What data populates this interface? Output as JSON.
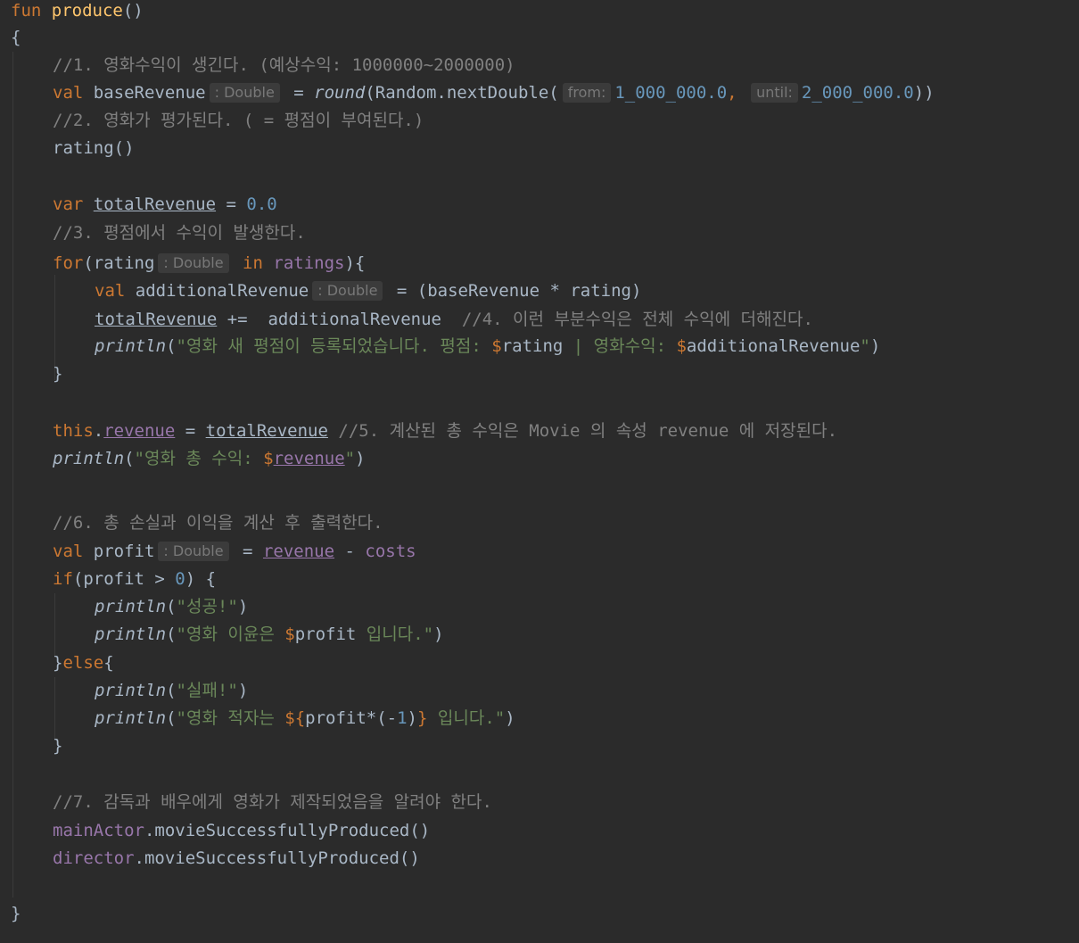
{
  "colors": {
    "background": "#2b2b2b",
    "text": "#a9b7c6",
    "keyword": "#cc7832",
    "function": "#ffc66d",
    "comment": "#808080",
    "number": "#6897bb",
    "string": "#6a8759",
    "property": "#9876aa",
    "hint_bg": "#3b3b3b"
  },
  "code": {
    "l1": {
      "kw": "fun",
      "fn": "produce",
      "rest": "()"
    },
    "l2": "{",
    "l3": {
      "comment": "//1. 영화수익이 생긴다. (예상수익: 1000000~2000000)"
    },
    "l4": {
      "kw": "val",
      "name": "baseRevenue",
      "hint": ": Double",
      "eq": "=",
      "fn": "round",
      "call": "(Random.nextDouble(",
      "hint_from": "from:",
      "arg1": "1_000_000.0",
      "comma": ",",
      "hint_until": "until:",
      "arg2": "2_000_000.0",
      "close": "))"
    },
    "l5": {
      "comment": "//2. 영화가 평가된다. ( = 평점이 부여된다.)"
    },
    "l6": "rating()",
    "l8": {
      "kw": "var",
      "name": "totalRevenue",
      "eq": "=",
      "num": "0.0"
    },
    "l9": {
      "comment": "//3. 평점에서 수익이 발생한다."
    },
    "l10": {
      "kw": "for",
      "open": "(rating",
      "hint": ": Double",
      "in": "in",
      "prop": "ratings",
      "close": "){"
    },
    "l11": {
      "kw": "val",
      "name": "additionalRevenue",
      "hint": ": Double",
      "expr": "= (baseRevenue * rating)"
    },
    "l12": {
      "var": "totalRevenue",
      "op": "+=  additionalRevenue",
      "comment": "//4. 이런 부분수익은 전체 수익에 더해진다."
    },
    "l13": {
      "fn": "println",
      "open": "(",
      "s1": "\"영화 새 평점이 등록되었습니다. 평점: ",
      "d1": "$",
      "v1": "rating",
      "s2": " | 영화수익: ",
      "d2": "$",
      "v2": "additionalRevenue",
      "s3": "\"",
      "close": ")"
    },
    "l14": "}",
    "l16": {
      "kw": "this",
      "dot": ".",
      "prop": "revenue",
      "eq": "=",
      "var": "totalRevenue",
      "comment": "//5. 계산된 총 수익은 Movie 의 속성 revenue 에 저장된다."
    },
    "l17": {
      "fn": "println",
      "open": "(",
      "s1": "\"영화 총 수익: ",
      "d1": "$",
      "v1": "revenue",
      "s2": "\"",
      "close": ")"
    },
    "l19": {
      "comment": "//6. 총 손실과 이익을 계산 후 출력한다."
    },
    "l20": {
      "kw": "val",
      "name": "profit",
      "hint": ": Double",
      "eq": "=",
      "prop1": "revenue",
      "op": "-",
      "prop2": "costs"
    },
    "l21": {
      "kw": "if",
      "open": "(profit > ",
      "num": "0",
      "close": ") {"
    },
    "l22": {
      "fn": "println",
      "open": "(",
      "s": "\"성공!\"",
      "close": ")"
    },
    "l23": {
      "fn": "println",
      "open": "(",
      "s1": "\"영화 이윤은 ",
      "d1": "$",
      "v1": "profit",
      "s2": " 입니다.\"",
      "close": ")"
    },
    "l24": {
      "brace": "}",
      "kw": "else",
      "open": "{"
    },
    "l25": {
      "fn": "println",
      "open": "(",
      "s": "\"실패!\"",
      "close": ")"
    },
    "l26": {
      "fn": "println",
      "open": "(",
      "s1": "\"영화 적자는 ",
      "d1": "${",
      "expr1": "profit*(-",
      "num": "1",
      "expr2": ")",
      "d2": "}",
      "s2": " 입니다.\"",
      "close": ")"
    },
    "l27": "}",
    "l29": {
      "comment": "//7. 감독과 배우에게 영화가 제작되었음을 알려야 한다."
    },
    "l30": {
      "prop": "mainActor",
      "rest": ".movieSuccessfullyProduced()"
    },
    "l31": {
      "prop": "director",
      "rest": ".movieSuccessfullyProduced()"
    },
    "l33": "}"
  }
}
